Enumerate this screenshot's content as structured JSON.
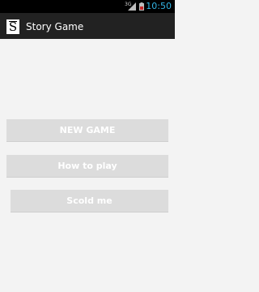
{
  "status_bar": {
    "network": "3G",
    "time": "10:50",
    "colors": {
      "accent": "#33b5e5",
      "battery": "#c62828"
    }
  },
  "action_bar": {
    "icon_letter": "S",
    "title": "Story Game"
  },
  "buttons": {
    "new_game": "NEW GAME",
    "how_to_play": "How to play",
    "scold_me": "Scold me"
  }
}
